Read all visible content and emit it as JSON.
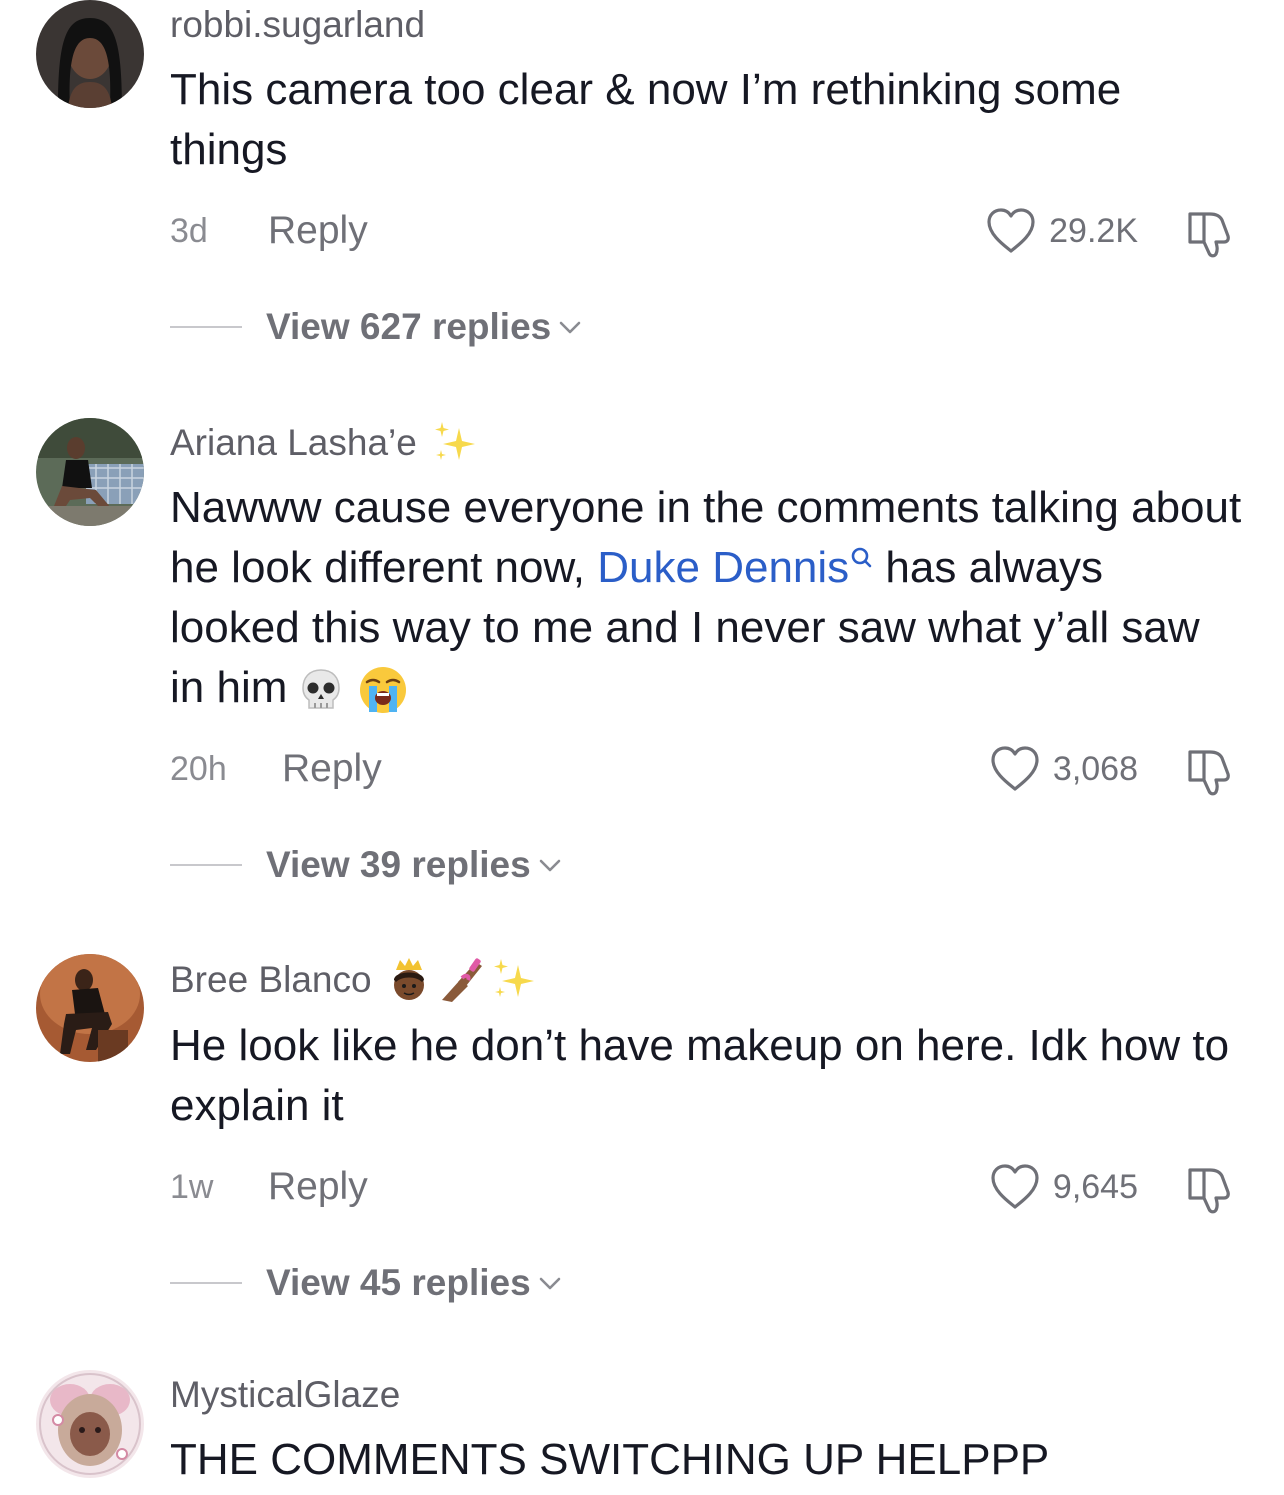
{
  "comments": [
    {
      "username": "robbi.sugarland",
      "text": "This camera too clear & now I’m rethinking some things",
      "time": "3d",
      "reply_label": "Reply",
      "likes": "29.2K",
      "view_replies": "View 627 replies"
    },
    {
      "username": "Ariana Lasha’e",
      "text_before": "Nawww cause everyone in the comments talking about he look different now, ",
      "mention": "Duke Dennis",
      "text_after": " has always looked this way to me and I never saw what y’all saw in him",
      "time": "20h",
      "reply_label": "Reply",
      "likes": "3,068",
      "view_replies": "View 39 replies"
    },
    {
      "username": "Bree Blanco",
      "text": "He look like he don’t have makeup on here. Idk how to explain it",
      "time": "1w",
      "reply_label": "Reply",
      "likes": "9,645",
      "view_replies": "View 45 replies"
    },
    {
      "username": "MysticalGlaze",
      "text": "THE COMMENTS SWITCHING UP HELPPP"
    }
  ],
  "icons": {
    "like": "heart-icon",
    "dislike": "thumbs-down-icon",
    "expand": "chevron-down-icon",
    "search_mention": "search-icon",
    "sparkles": "sparkles-emoji",
    "skull": "skull-emoji",
    "crying": "loudly-crying-face-emoji",
    "princess": "princess-emoji",
    "nail_polish": "nail-polish-emoji"
  },
  "colors": {
    "mention": "#2b5ec8",
    "primary_text": "#161823",
    "secondary_text": "#6f7077"
  }
}
